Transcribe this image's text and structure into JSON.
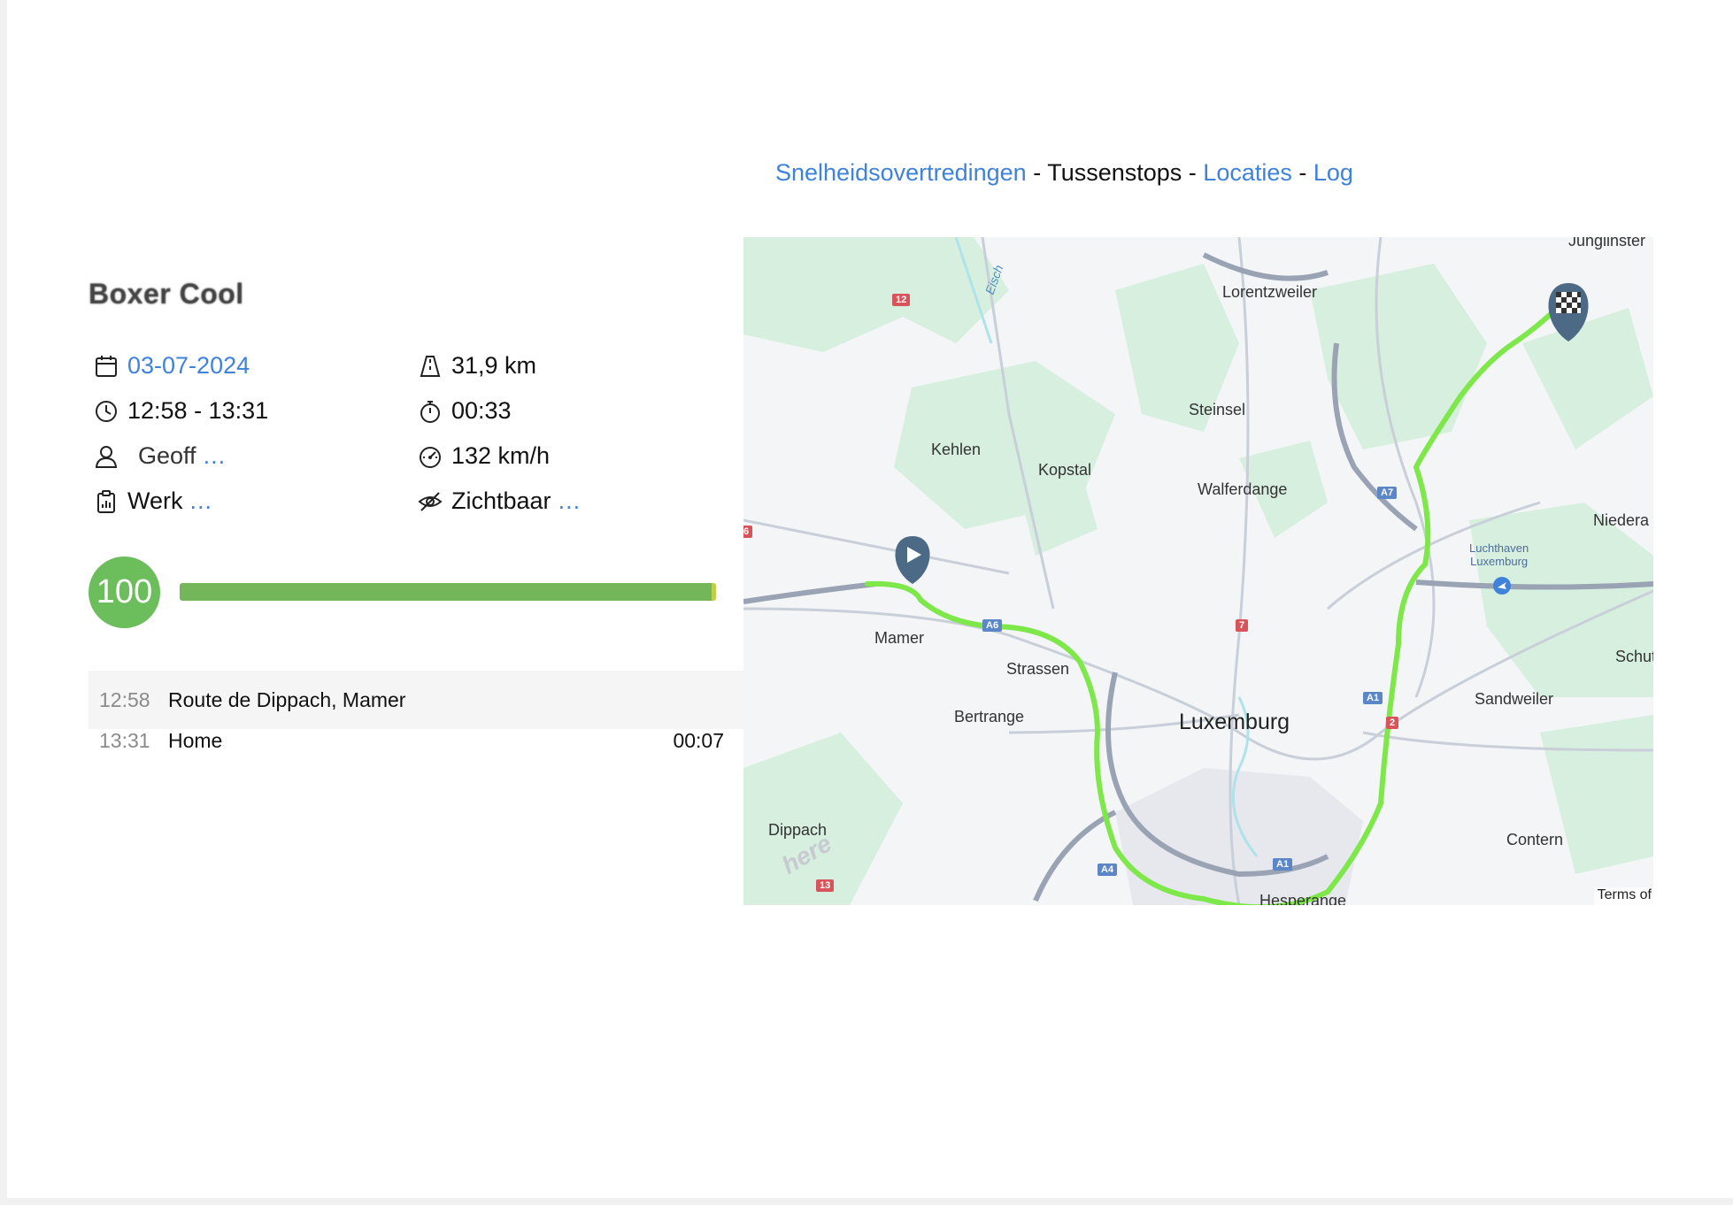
{
  "nav": {
    "speeding": "Snelheidsovertredingen",
    "sep1": " - ",
    "stops": "Tussenstops",
    "sep2": " - ",
    "locations": "Locaties",
    "sep3": " - ",
    "log": "Log"
  },
  "trip": {
    "vehicle": "Boxer Cool",
    "date": "03-07-2024",
    "distance": "31,9 km",
    "time_range": "12:58 - 13:31",
    "duration": "00:33",
    "driver": "Geoff",
    "driver_more": "...",
    "max_speed": "132 km/h",
    "type": "Werk",
    "type_more": "...",
    "visibility": "Zichtbaar",
    "visibility_more": "..."
  },
  "score": {
    "value": "100",
    "fraction": 1.0,
    "colors": {
      "good": "#6cbd5b",
      "bar": "#73b75a"
    }
  },
  "stops": [
    {
      "time": "12:58",
      "label": "Route de Dippach, Mamer",
      "duration": ""
    },
    {
      "time": "13:31",
      "label": "Home",
      "duration": "00:07"
    }
  ],
  "map": {
    "labels": {
      "lorentzweiler": "Lorentzweiler",
      "steinsel": "Steinsel",
      "kehlen": "Kehlen",
      "kopstal": "Kopstal",
      "walferdange": "Walferdange",
      "niederanven": "Niedera",
      "luchthaven": "Luchthaven\nLuxemburg",
      "mamer": "Mamer",
      "strassen": "Strassen",
      "bertrange": "Bertrange",
      "luxemburg": "Luxemburg",
      "sandweiler": "Sandweiler",
      "schuttrange": "Schut",
      "contern": "Contern",
      "dippach": "Dippach",
      "hesperange": "Hesperange",
      "junglinster": "Junglinster",
      "eisch": "Eisch"
    },
    "road_badges": [
      "12",
      "A7",
      "A6",
      "7",
      "A1",
      "2",
      "A4",
      "A1",
      "13",
      "6"
    ],
    "terms": "Terms of",
    "brand": "here",
    "route_color": "#7ee74a"
  }
}
